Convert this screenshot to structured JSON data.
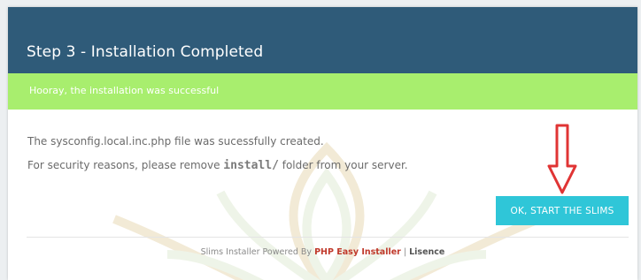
{
  "header": {
    "title": "Step 3 - Installation Completed"
  },
  "alert": {
    "message": "Hooray, the installation was successful"
  },
  "body": {
    "line1": "The sysconfig.local.inc.php file was sucessfully created.",
    "line2_prefix": "For security reasons, please remove ",
    "line2_code": "install/",
    "line2_suffix": " folder from your server."
  },
  "actions": {
    "start_label": "OK, START THE SLIMS"
  },
  "footer": {
    "prefix": "Slims Installer Powered By ",
    "link_label": "PHP Easy Installer",
    "separator": " | ",
    "license_label": "Lisence"
  },
  "colors": {
    "header_bg": "#2f5b79",
    "success_bg": "#a8ee6e",
    "button_bg": "#2fc6d8",
    "arrow": "#e03434"
  },
  "icons": {
    "annotation": "down-arrow-icon",
    "background": "watermark-emblem"
  }
}
